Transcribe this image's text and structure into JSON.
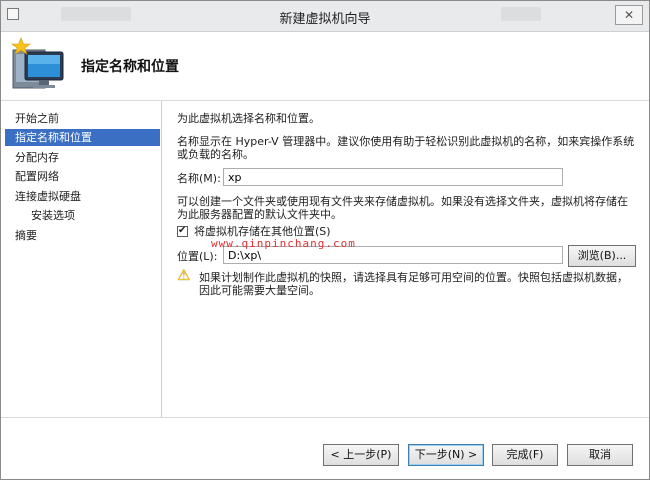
{
  "window": {
    "title": "新建虚拟机向导",
    "close_glyph": "✕"
  },
  "header": {
    "title": "指定名称和位置",
    "icon": "new-vm-monitor-icon"
  },
  "sidebar": {
    "items": [
      {
        "label": "开始之前"
      },
      {
        "label": "指定名称和位置",
        "selected": true
      },
      {
        "label": "分配内存"
      },
      {
        "label": "配置网络"
      },
      {
        "label": "连接虚拟硬盘"
      },
      {
        "label": "安装选项"
      },
      {
        "label": "摘要"
      }
    ]
  },
  "main": {
    "intro": "为此虚拟机选择名称和位置。",
    "desc_line1": "名称显示在 Hyper-V 管理器中。建议你使用有助于轻松识别此虚拟机的名称，如来宾操作系统",
    "desc_line2": "或负载的名称。",
    "name_label": "名称(M):",
    "name_value": "xp",
    "folder_line1": "可以创建一个文件夹或使用现有文件夹来存储虚拟机。如果没有选择文件夹，虚拟机将存储在",
    "folder_line2": "为此服务器配置的默认文件夹中。",
    "store_checkbox_label": "将虚拟机存储在其他位置(S)",
    "store_checked": true,
    "check_glyph": "✔",
    "location_label": "位置(L):",
    "location_value": "D:\\xp\\",
    "browse_label": "浏览(B)...",
    "warning_glyph": "⚠",
    "warning_line1": "如果计划制作此虚拟机的快照，请选择具有足够可用空间的位置。快照包括虚拟机数据，",
    "warning_line2": "因此可能需要大量空间。",
    "watermark": "www.qinpinchang.com"
  },
  "footer": {
    "prev_label": "< 上一步(P)",
    "next_label": "下一步(N) >",
    "finish_label": "完成(F)",
    "cancel_label": "取消"
  },
  "colors": {
    "selected_nav": "#3a6fc4",
    "watermark": "#e33030",
    "warning_yellow": "#f2c200"
  }
}
